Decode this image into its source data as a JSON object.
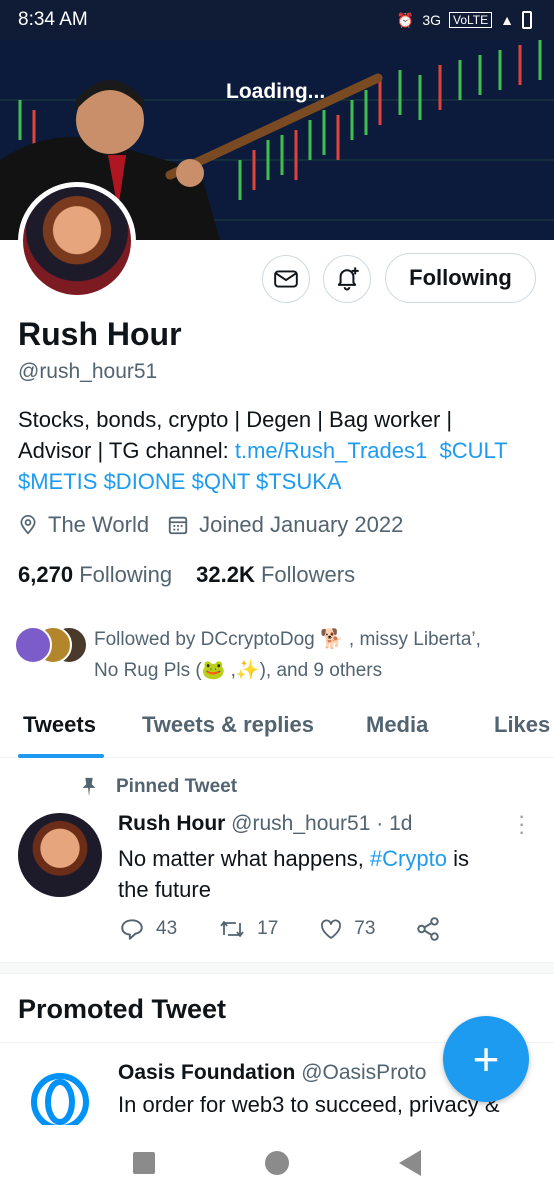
{
  "status": {
    "time": "8:34 AM",
    "network": "3G",
    "volte": "VoLTE"
  },
  "banner": {
    "loading": "Loading..."
  },
  "profile": {
    "name": "Rush Hour",
    "handle": "@rush_hour51",
    "bio_line1": "Stocks, bonds, crypto | Degen | Bag worker |",
    "bio_line2_prefix": "Advisor | TG channel: ",
    "bio_link": "t.me/Rush_Trades1",
    "bio_cult": "$CULT",
    "bio_line3": "$METIS $DIONE $QNT $TSUKA",
    "location": "The World",
    "joined": "Joined January 2022",
    "following_count": "6,270",
    "following_label": "Following",
    "followers_count": "32.2K",
    "followers_label": "Followers",
    "followed_by_line1": "Followed by DCcryptoDog 🐕 , missy Liberta’,",
    "followed_by_line2": "No Rug Pls (🐸 ,✨), and 9 others",
    "follow_button": "Following"
  },
  "tabs": [
    "Tweets",
    "Tweets & replies",
    "Media",
    "Likes"
  ],
  "pinned_tweet": {
    "pinned_label": "Pinned Tweet",
    "name": "Rush Hour",
    "meta": "@rush_hour51 · 1d",
    "text_prefix": "No matter what happens, ",
    "hashtag": "#Crypto",
    "text_suffix": " is",
    "text_line2": "the future",
    "replies": "43",
    "retweets": "17",
    "likes": "73"
  },
  "promoted": {
    "title": "Promoted Tweet",
    "name": "Oasis Foundation",
    "handle": "@OasisProto",
    "text": "In order for web3 to succeed, privacy &"
  },
  "colors": {
    "accent": "#1d9bf0",
    "status_bar": "#101b35"
  }
}
